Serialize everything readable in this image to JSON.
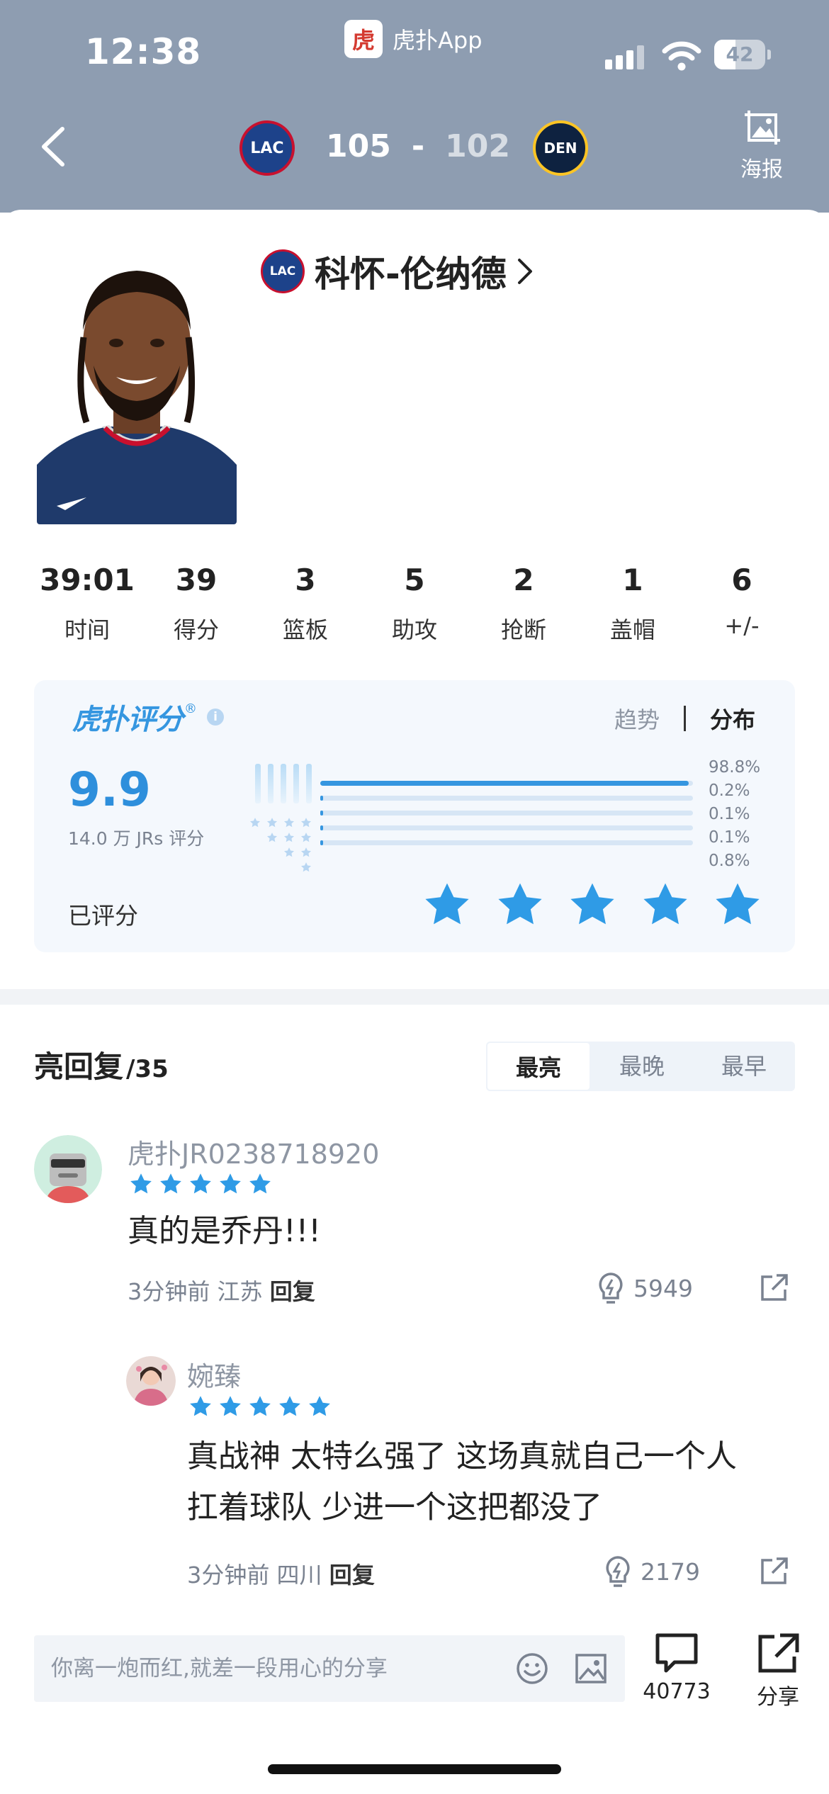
{
  "status_bar": {
    "time": "12:38",
    "app_name": "虎扑App",
    "app_logo_char": "虎",
    "battery_level": "42",
    "battery_fraction": 0.42
  },
  "nav": {
    "home_team_abbr": "LAC",
    "away_team_abbr": "DEN",
    "home_score": "105",
    "separator": "-",
    "away_score": "102",
    "poster_label": "海报"
  },
  "player": {
    "name": "科怀-伦纳德",
    "team_abbr": "LAC"
  },
  "stats": [
    {
      "value": "39:01",
      "label": "时间"
    },
    {
      "value": "39",
      "label": "得分"
    },
    {
      "value": "3",
      "label": "篮板"
    },
    {
      "value": "5",
      "label": "助攻"
    },
    {
      "value": "2",
      "label": "抢断"
    },
    {
      "value": "1",
      "label": "盖帽"
    },
    {
      "value": "6",
      "label": "+/-"
    }
  ],
  "rating": {
    "brand": "虎扑评分",
    "brand_mark": "®",
    "info_glyph": "i",
    "tabs": {
      "trend": "趋势",
      "distribution": "分布"
    },
    "score": "9.9",
    "count_label": "14.0 万 JRs 评分",
    "rated_label": "已评分",
    "user_rating_stars": 5,
    "distribution": [
      {
        "stars": 5,
        "percent_label": "98.8%",
        "fraction": 0.988
      },
      {
        "stars": 4,
        "percent_label": "0.2%",
        "fraction": 0.002
      },
      {
        "stars": 3,
        "percent_label": "0.1%",
        "fraction": 0.001
      },
      {
        "stars": 2,
        "percent_label": "0.1%",
        "fraction": 0.001
      },
      {
        "stars": 1,
        "percent_label": "0.8%",
        "fraction": 0.008
      }
    ]
  },
  "replies": {
    "title": "亮回复",
    "count": "/35",
    "sort_tabs": [
      "最亮",
      "最晚",
      "最早"
    ],
    "active_sort": 0,
    "comments": [
      {
        "user": "虎扑JR0238718920",
        "stars": 5,
        "text_lines": [
          "真的是乔丹!!!"
        ],
        "time": "3分钟前",
        "location": "江苏",
        "reply_label": "回复",
        "likes": "5949"
      },
      {
        "user": "婉臻",
        "stars": 5,
        "text_lines": [
          "真战神 太特么强了 这场真就自己一个人",
          "扛着球队 少进一个这把都没了"
        ],
        "time": "3分钟前",
        "location": "四川",
        "reply_label": "回复",
        "likes": "2179"
      }
    ]
  },
  "bottom_bar": {
    "input_placeholder": "你离一炮而红,就差一段用心的分享",
    "comments_count": "40773",
    "share_label": "分享"
  },
  "colors": {
    "header_bg": "#8e9db1",
    "accent_blue": "#3596e0",
    "star_blue": "#2f9be6",
    "clippers_blue": "#1d428a",
    "clippers_red": "#c8102e",
    "nuggets_navy": "#0e2240",
    "nuggets_gold": "#fec524"
  },
  "icons": {
    "back": "chevron-left-icon",
    "poster": "image-crop-icon",
    "like": "lightbulb-icon",
    "share": "external-share-icon",
    "emoji": "smile-icon",
    "image": "image-icon",
    "comment": "chat-bubble-icon"
  }
}
